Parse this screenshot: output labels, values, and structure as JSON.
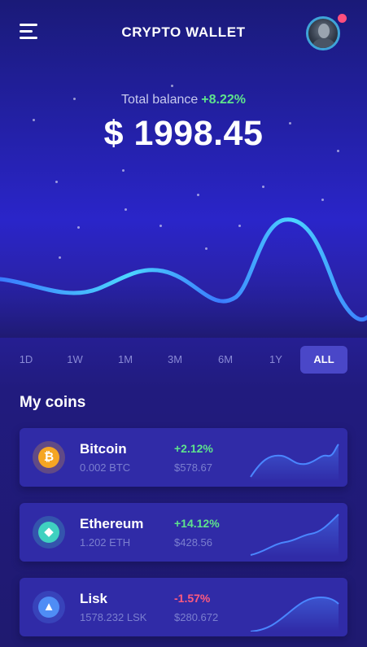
{
  "header": {
    "title": "CRYPTO WALLET",
    "menu_icon": "hamburger-menu-icon",
    "avatar_icon": "user-avatar",
    "notification_color": "#ff4f7e"
  },
  "balance": {
    "label": "Total balance",
    "change": "+8.22%",
    "amount": "$ 1998.45"
  },
  "periods": [
    "1D",
    "1W",
    "1M",
    "3M",
    "6M",
    "1Y",
    "ALL"
  ],
  "selected_period": "ALL",
  "coins_section": {
    "title": "My coins",
    "coins": [
      {
        "name": "Bitcoin",
        "amount": "0.002 BTC",
        "change": "+2.12%",
        "value": "$578.67",
        "icon": "bitcoin-icon",
        "color": "#f5a623",
        "trend": "up"
      },
      {
        "name": "Ethereum",
        "amount": "1.202 ETH",
        "change": "+14.12%",
        "value": "$428.56",
        "icon": "ethereum-icon",
        "color": "#3fd1c0",
        "trend": "up"
      },
      {
        "name": "Lisk",
        "amount": "1578.232 LSK",
        "change": "-1.57%",
        "value": "$280.672",
        "icon": "lisk-icon",
        "color": "#4f8df5",
        "trend": "down"
      }
    ]
  },
  "colors": {
    "accent_green": "#5ee38c",
    "accent_red": "#ff5a7e",
    "chart_line": "#42d4ff",
    "active_period_bg": "#4a47c8"
  }
}
